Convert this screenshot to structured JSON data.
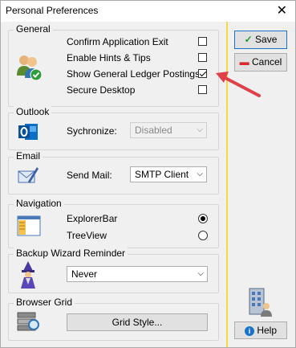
{
  "window": {
    "title": "Personal Preferences",
    "close_glyph": "✕"
  },
  "general": {
    "legend": "General",
    "icon": "users-check-icon",
    "options": [
      {
        "label": "Confirm Application Exit",
        "checked": false
      },
      {
        "label": "Enable Hints & Tips",
        "checked": false
      },
      {
        "label": "Show General Ledger Postings",
        "checked": true
      },
      {
        "label": "Secure Desktop",
        "checked": false
      }
    ]
  },
  "outlook": {
    "legend": "Outlook",
    "icon": "outlook-icon",
    "label": "Sychronize:",
    "value": "Disabled"
  },
  "email": {
    "legend": "Email",
    "icon": "mail-pen-icon",
    "label": "Send Mail:",
    "value": "SMTP Client"
  },
  "navigation": {
    "legend": "Navigation",
    "icon": "explorer-window-icon",
    "options": [
      {
        "label": "ExplorerBar",
        "selected": true
      },
      {
        "label": "TreeView",
        "selected": false
      }
    ]
  },
  "backup": {
    "legend": "Backup Wizard Reminder",
    "icon": "wizard-icon",
    "value": "Never"
  },
  "browser_grid": {
    "legend": "Browser Grid",
    "icon": "grid-db-icon",
    "button": "Grid Style..."
  },
  "actions": {
    "save": "Save",
    "save_icon": "checkmark-icon",
    "cancel": "Cancel",
    "cancel_icon": "minus-icon",
    "help": "Help",
    "help_icon": "info-icon",
    "building_icon": "building-user-icon"
  },
  "annotation": {
    "color": "#e0404a",
    "icon": "red-arrow-icon"
  }
}
